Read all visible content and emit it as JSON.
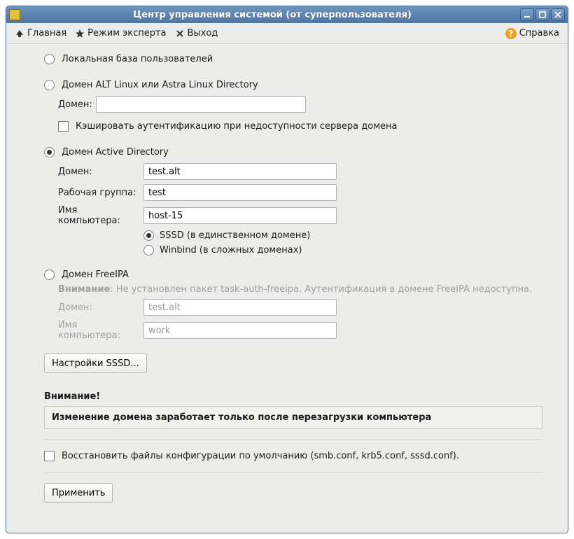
{
  "window": {
    "title": "Центр управления системой (от суперпользователя)"
  },
  "toolbar": {
    "home": "Главная",
    "expert": "Режим эксперта",
    "exit": "Выход",
    "help": "Справка"
  },
  "auth": {
    "local": {
      "label": "Локальная база пользователей"
    },
    "alt": {
      "label": "Домен ALT Linux или Astra Linux Directory",
      "domain_label": "Домен:",
      "domain_value": "",
      "cache_label": "Кэшировать аутентификацию при недоступности сервера домена"
    },
    "ad": {
      "label": "Домен Active Directory",
      "domain_label": "Домен:",
      "domain_value": "test.alt",
      "workgroup_label": "Рабочая группа:",
      "workgroup_value": "test",
      "hostname_label": "Имя компьютера:",
      "hostname_value": "host-15",
      "sssd_label": "SSSD (в единственном домене)",
      "winbind_label": "Winbind (в сложных доменах)"
    },
    "freeipa": {
      "label": "Домен FreeIPA",
      "warn_prefix": "Внимание",
      "warn_text": ": Не установлен пакет task-auth-freeipa. Аутентификация в домене FreeIPA недоступна.",
      "domain_label": "Домен:",
      "domain_value": "test.alt",
      "hostname_label": "Имя компьютера:",
      "hostname_value": "work"
    }
  },
  "sssd_settings_btn": "Настройки SSSD...",
  "notice": {
    "heading": "Внимание!",
    "text": "Изменение домена заработает только после перезагрузки компьютера"
  },
  "restore_label": "Восстановить файлы конфигурации по умолчанию (smb.conf, krb5.conf, sssd.conf).",
  "apply_btn": "Применить"
}
